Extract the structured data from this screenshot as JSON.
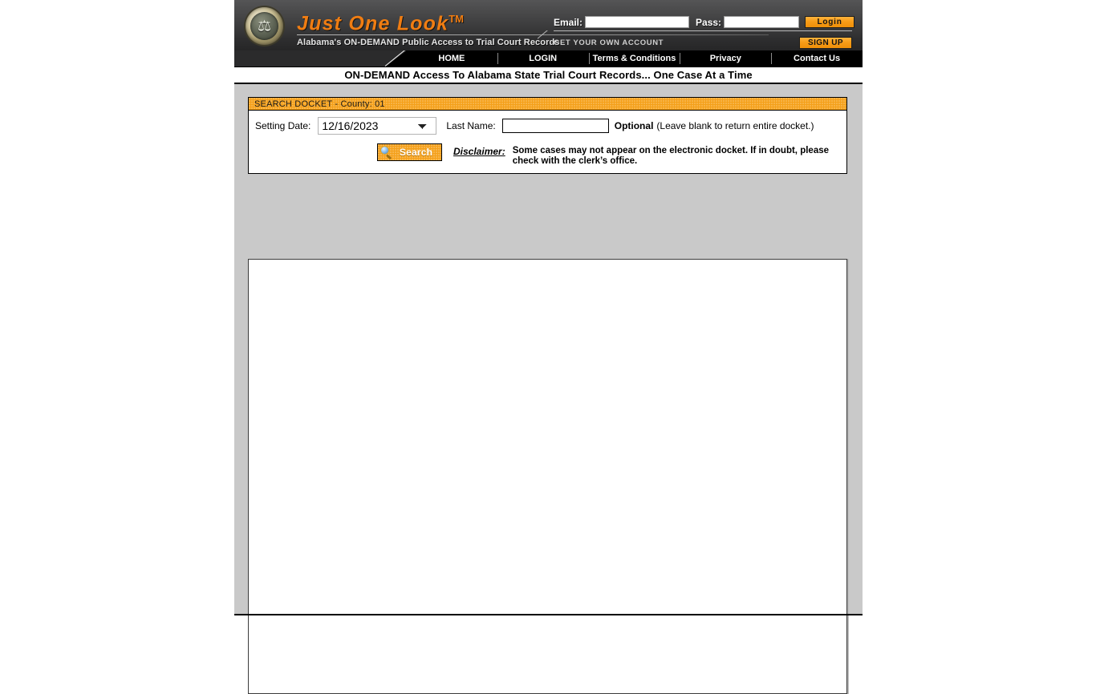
{
  "header": {
    "brand_title": "Just One Look",
    "brand_tm": "TM",
    "brand_subtitle": "Alabama's ON-DEMAND Public Access to Trial Court Records",
    "seal_icon": "scales-of-justice-seal",
    "email_label": "Email:",
    "email_value": "",
    "pass_label": "Pass:",
    "pass_value": "",
    "login_button": "Login",
    "account_text": "GET YOUR OWN ACCOUNT",
    "signup_button": "SIGN UP",
    "accent_orange": "#f07d12"
  },
  "nav": {
    "items": [
      {
        "label": "HOME"
      },
      {
        "label": "LOGIN"
      },
      {
        "label": "Terms & Conditions"
      },
      {
        "label": "Privacy"
      },
      {
        "label": "Contact Us"
      }
    ]
  },
  "tagline": "ON-DEMAND Access To Alabama State Trial Court Records... One Case At a Time",
  "search_panel": {
    "title": "SEARCH DOCKET - County: 01",
    "title_bg": "#f5a019",
    "setting_date_label": "Setting Date:",
    "setting_date_value": "12/16/2023",
    "setting_date_options": [
      "12/16/2023"
    ],
    "last_name_label": "Last Name:",
    "last_name_value": "",
    "last_name_placeholder": "",
    "optional_bold": "Optional",
    "optional_note": "(Leave blank to return entire docket.)",
    "search_button": "Search",
    "search_icon": "magnifying-glass-icon",
    "disclaimer_label": "Disclaimer:",
    "disclaimer_text": "Some cases may not appear on the electronic docket. If in doubt, please check with the clerk’s office."
  },
  "results": {
    "content": ""
  }
}
